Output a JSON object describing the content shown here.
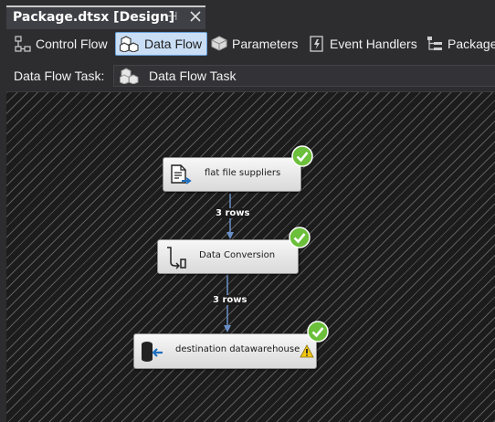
{
  "document_tab": {
    "title": "Package.dtsx [Design]"
  },
  "designer_tabs": [
    {
      "label": "Control Flow",
      "icon": "control-flow-icon",
      "active": false
    },
    {
      "label": "Data Flow",
      "icon": "data-flow-icon",
      "active": true
    },
    {
      "label": "Parameters",
      "icon": "parameters-icon",
      "active": false
    },
    {
      "label": "Event Handlers",
      "icon": "event-handlers-icon",
      "active": false
    },
    {
      "label": "Package",
      "icon": "package-explorer-icon",
      "active": false
    }
  ],
  "task_bar": {
    "label": "Data Flow Task:",
    "selected": "Data Flow Task"
  },
  "components": [
    {
      "label": "flat file suppliers",
      "icon": "flat-file-source-icon",
      "status": "success",
      "warning": false
    },
    {
      "label": "Data Conversion",
      "icon": "data-conversion-icon",
      "status": "success",
      "warning": false
    },
    {
      "label": "destination datawarehouse",
      "icon": "db-destination-icon",
      "status": "success",
      "warning": true
    }
  ],
  "paths": [
    {
      "label": "3 rows"
    },
    {
      "label": "3 rows"
    }
  ],
  "colors": {
    "accent": "#c9def5",
    "success": "#6bbf3a",
    "warning": "#f2c811",
    "connector": "#6a8fc7"
  }
}
